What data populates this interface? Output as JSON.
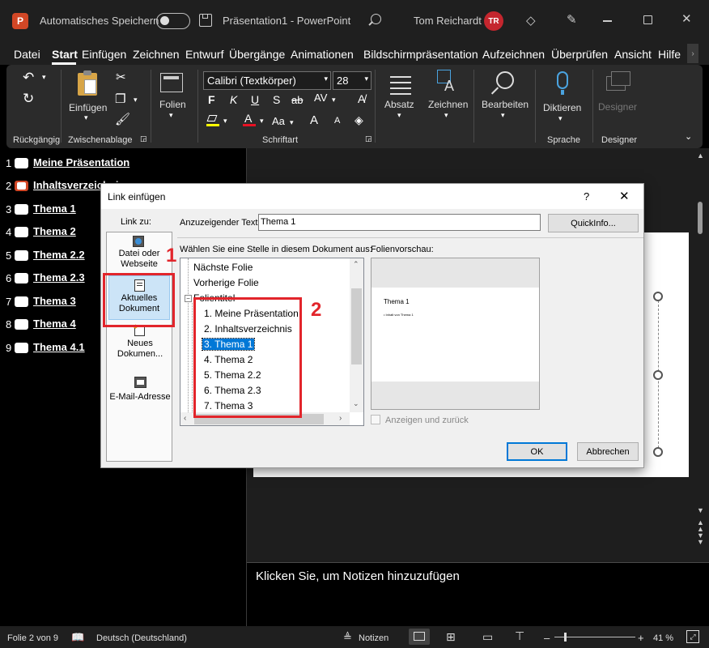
{
  "titlebar": {
    "app_icon": "powerpoint-icon",
    "autosave_label": "Automatisches Speichern",
    "autosave_state": "off",
    "doc_title": "Präsentation1  -  PowerPoint",
    "user_name": "Tom Reichardt",
    "user_initials": "TR"
  },
  "tabs": [
    "Datei",
    "Start",
    "Einfügen",
    "Zeichnen",
    "Entwurf",
    "Übergänge",
    "Animationen",
    "Bildschirmpräsentation",
    "Aufzeichnen",
    "Überprüfen",
    "Ansicht",
    "Hilfe"
  ],
  "active_tab": "Start",
  "ribbon": {
    "groups": {
      "undo": "Rückgängig",
      "clipboard": "Zwischenablage",
      "font": "Schriftart",
      "voice": "Sprache",
      "designer": "Designer"
    },
    "buttons": {
      "paste": "Einfügen",
      "slides": "Folien",
      "paragraph": "Absatz",
      "drawing": "Zeichnen",
      "editing": "Bearbeiten",
      "dictate": "Diktieren",
      "designer": "Designer"
    },
    "font_name": "Calibri (Textkörper)",
    "font_size": "28",
    "format": {
      "bold": "F",
      "italic": "K",
      "underline": "U",
      "shadow": "S",
      "strike": "ab",
      "spacing": "AV",
      "fontcolor": "A",
      "case": "Aa",
      "grow": "A",
      "shrink": "A"
    }
  },
  "slides": [
    {
      "num": "1",
      "title": "Meine Präsentation"
    },
    {
      "num": "2",
      "title": "Inhaltsverzeichnis"
    },
    {
      "num": "3",
      "title": "Thema 1"
    },
    {
      "num": "4",
      "title": "Thema 2"
    },
    {
      "num": "5",
      "title": "Thema 2.2"
    },
    {
      "num": "6",
      "title": "Thema 2.3"
    },
    {
      "num": "7",
      "title": "Thema 3"
    },
    {
      "num": "8",
      "title": "Thema 4"
    },
    {
      "num": "9",
      "title": "Thema 4.1"
    }
  ],
  "notes_placeholder": "Klicken Sie, um Notizen hinzuzufügen",
  "statusbar": {
    "slide_info": "Folie 2 von 9",
    "language": "Deutsch (Deutschland)",
    "notes": "Notizen",
    "zoom": "41 %",
    "zoom_minus": "–",
    "zoom_plus": "+"
  },
  "dialog": {
    "title": "Link einfügen",
    "help": "?",
    "close": "✕",
    "link_to_label": "Link zu:",
    "link_options": [
      "Datei oder Webseite",
      "Aktuelles Dokument",
      "Neues Dokumen...",
      "E-Mail-Adresse"
    ],
    "display_text_label": "Anzuzeigender Text:",
    "display_text_value": "Thema 1",
    "quickinfo": "QuickInfo...",
    "place_label": "Wählen Sie eine Stelle in diesem Dokument aus:",
    "tree_top": [
      "Nächste Folie",
      "Vorherige Folie"
    ],
    "tree_group": "Folientitel",
    "tree_children": [
      "1. Meine Präsentation",
      "2. Inhaltsverzeichnis",
      "3. Thema 1",
      "4. Thema 2",
      "5. Thema 2.2",
      "6. Thema 2.3",
      "7. Thema 3"
    ],
    "selected_item": "3. Thema 1",
    "preview_label": "Folienvorschau:",
    "preview_title": "Thema 1",
    "preview_bullet": "• Inhalt von Thema 1",
    "show_return_label": "Anzeigen und zurück",
    "ok": "OK",
    "cancel": "Abbrechen"
  },
  "annotations": [
    "1",
    "2"
  ],
  "colors": {
    "annotation_red": "#e2252b",
    "selection_blue": "#0078d7",
    "avatar_red": "#c4262e",
    "powerpoint_orange": "#d24726"
  }
}
